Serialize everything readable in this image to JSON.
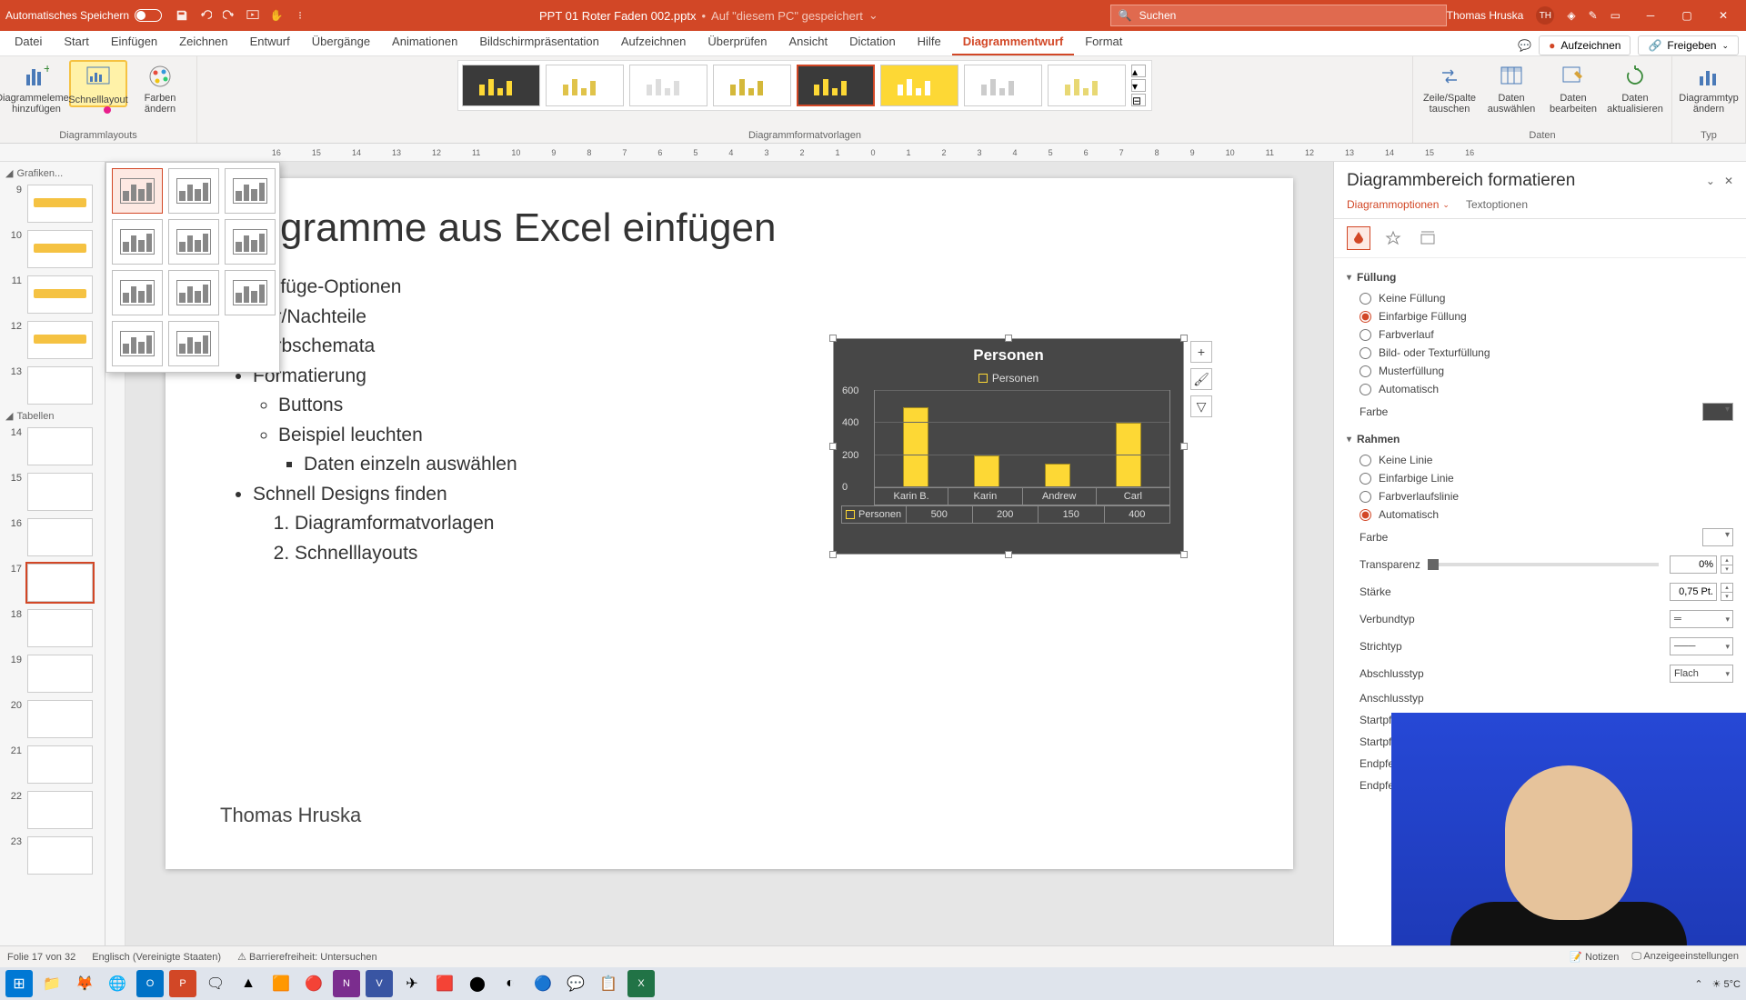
{
  "titlebar": {
    "autosave": "Automatisches Speichern",
    "filename": "PPT 01 Roter Faden 002.pptx",
    "saved_state": "Auf \"diesem PC\" gespeichert",
    "search_placeholder": "Suchen",
    "user_name": "Thomas Hruska",
    "user_initials": "TH"
  },
  "tabs": {
    "items": [
      "Datei",
      "Start",
      "Einfügen",
      "Zeichnen",
      "Entwurf",
      "Übergänge",
      "Animationen",
      "Bildschirmpräsentation",
      "Aufzeichnen",
      "Überprüfen",
      "Ansicht",
      "Dictation",
      "Hilfe",
      "Diagrammentwurf",
      "Format"
    ],
    "active": "Diagrammentwurf",
    "record": "Aufzeichnen",
    "share": "Freigeben"
  },
  "ribbon": {
    "add_element": "Diagrammelement hinzufügen",
    "quick_layout": "Schnelllayout",
    "change_colors": "Farben ändern",
    "group_layouts": "Diagrammlayouts",
    "group_styles": "Diagrammformatvorlagen",
    "swap": "Zeile/Spalte tauschen",
    "select_data": "Daten auswählen",
    "edit_data": "Daten bearbeiten",
    "refresh_data": "Daten aktualisieren",
    "group_data": "Daten",
    "change_type": "Diagrammtyp ändern",
    "group_type": "Typ"
  },
  "thumbs": {
    "group1": "Grafiken...",
    "group2": "Tabellen",
    "slides": [
      9,
      10,
      11,
      12,
      13,
      14,
      15,
      16,
      17,
      18,
      19,
      20,
      21,
      22,
      23
    ],
    "current": 17
  },
  "slide": {
    "title": "Diagramme aus Excel einfügen",
    "bul1": "Einfüge-Optionen",
    "bul2": "Vor/Nachteile",
    "bul3": "Farbschemata",
    "bul4": "Formatierung",
    "bul4a": "Buttons",
    "bul4b": "Beispiel leuchten",
    "bul4b1": "Daten einzeln auswählen",
    "bul5": "Schnell Designs finden",
    "bul5_1": "Diagramformatvorlagen",
    "bul5_2": "Schnelllayouts",
    "footer": "Thomas Hruska"
  },
  "chart_data": {
    "type": "bar",
    "title": "Personen",
    "legend": "Personen",
    "categories": [
      "Karin B.",
      "Karin",
      "Andrew",
      "Carl"
    ],
    "values": [
      500,
      200,
      150,
      400
    ],
    "ylim": [
      0,
      600
    ],
    "yticks": [
      0,
      200,
      400,
      600
    ],
    "series_label": "Personen"
  },
  "fmt": {
    "title": "Diagrammbereich formatieren",
    "tab_opts": "Diagrammoptionen",
    "tab_text": "Textoptionen",
    "sect_fill": "Füllung",
    "fill_none": "Keine Füllung",
    "fill_solid": "Einfarbige Füllung",
    "fill_grad": "Farbverlauf",
    "fill_pic": "Bild- oder Texturfüllung",
    "fill_patt": "Musterfüllung",
    "fill_auto": "Automatisch",
    "color": "Farbe",
    "sect_border": "Rahmen",
    "line_none": "Keine Linie",
    "line_solid": "Einfarbige Linie",
    "line_grad": "Farbverlaufslinie",
    "line_auto": "Automatisch",
    "transp": "Transparenz",
    "transp_val": "0%",
    "width": "Stärke",
    "width_val": "0,75 Pt.",
    "compound": "Verbundtyp",
    "dash": "Strichtyp",
    "cap": "Abschlusstyp",
    "cap_val": "Flach",
    "join": "Anschlusstyp",
    "arrow_start": "Startpfeiltyp",
    "arrow_start_size": "Startpfeilgröße",
    "arrow_end": "Endpfeiltyp",
    "arrow_end_size": "Endpfeilgröße"
  },
  "status": {
    "slide_of": "Folie 17 von 32",
    "lang": "Englisch (Vereinigte Staaten)",
    "access": "Barrierefreiheit: Untersuchen",
    "notes": "Notizen",
    "display": "Anzeigeeinstellungen"
  },
  "taskbar": {
    "temp": "5°C"
  },
  "ruler_marks": [
    "16",
    "15",
    "14",
    "13",
    "12",
    "11",
    "10",
    "9",
    "8",
    "7",
    "6",
    "5",
    "4",
    "3",
    "2",
    "1",
    "0",
    "1",
    "2",
    "3",
    "4",
    "5",
    "6",
    "7",
    "8",
    "9",
    "10",
    "11",
    "12",
    "13",
    "14",
    "15",
    "16"
  ]
}
